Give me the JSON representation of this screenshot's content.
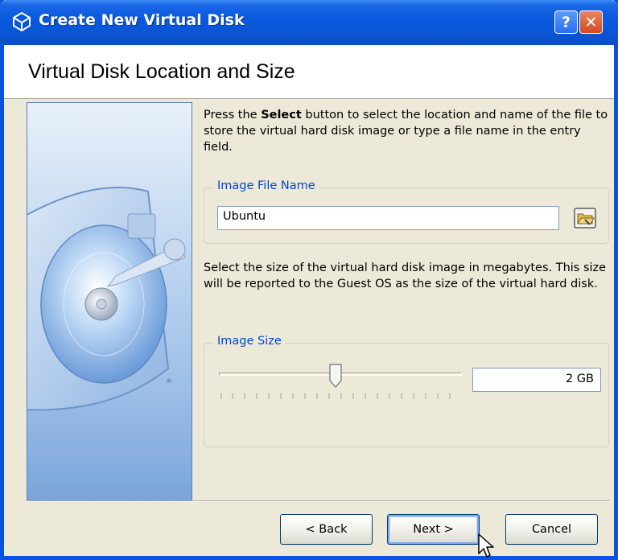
{
  "window": {
    "title": "Create New Virtual Disk",
    "help_label": "?",
    "close_label": "✕"
  },
  "header": {
    "title": "Virtual Disk Location and Size"
  },
  "location": {
    "description_before": "Press the ",
    "description_bold": "Select",
    "description_after": " button to select the location and name of the file to store the virtual hard disk image or type a file name in the entry field.",
    "group_label": "Image File Name",
    "file_name_value": "Ubuntu",
    "select_button_icon": "folder-icon"
  },
  "size": {
    "description": "Select the size of the virtual hard disk image in megabytes. This size will be reported to the Guest OS as the size of the virtual hard disk.",
    "group_label": "Image Size",
    "size_value": "2 GB",
    "slider_level": 0.48
  },
  "buttons": {
    "back": "< Back",
    "next": "Next >",
    "cancel": "Cancel"
  },
  "colors": {
    "titlebar": "#0a55d6",
    "group_label": "#0046d5",
    "dialog_bg": "#ece9d8"
  }
}
